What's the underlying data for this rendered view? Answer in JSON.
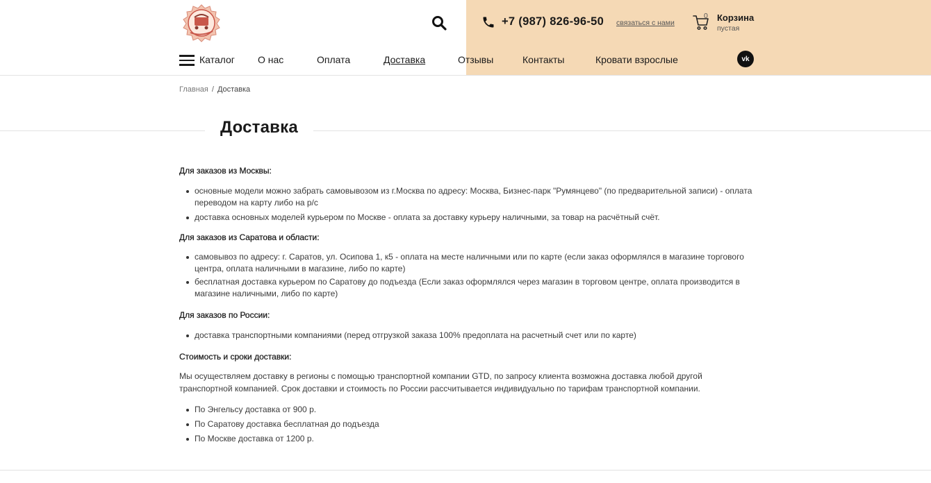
{
  "header": {
    "logo_icon": "home-baby-logo",
    "search_icon": "search-icon",
    "phone_icon": "phone-icon",
    "phone": "+7 (987) 826-96-50",
    "contact_link": "связаться с нами",
    "cart": {
      "icon": "cart-icon",
      "count": "0",
      "title": "Корзина",
      "status": "пустая"
    },
    "peach_color": "#f5d9b5"
  },
  "nav": {
    "catalog": "Каталог",
    "items": [
      "О нас",
      "Оплата",
      "Доставка",
      "Отзывы",
      "Контакты",
      "Кровати взрослые"
    ],
    "active": "Доставка",
    "vk_label": "vk"
  },
  "breadcrumb": {
    "home": "Главная",
    "separator": "/",
    "current": "Доставка"
  },
  "page_title": "Доставка",
  "sections": {
    "moscow": {
      "heading": "Для заказов из Москвы:",
      "items": [
        "основные модели можно забрать самовывозом из г.Москва по адресу: Москва, Бизнес-парк \"Румянцево\" (по предварительной записи) - оплата переводом на карту либо на р/с",
        "доставка основных моделей курьером по Москве - оплата за доставку курьеру наличными, за товар на расчётный счёт."
      ]
    },
    "saratov": {
      "heading": "Для заказов из Саратова и области:",
      "items": [
        "самовывоз по адресу: г. Саратов, ул. Осипова 1, к5 - оплата на месте наличными или по карте (если заказ оформлялся в магазине торгового центра, оплата наличными в магазине, либо по карте)",
        "бесплатная доставка курьером по Саратову до подъезда (Если заказ оформлялся через магазин в торговом центре, оплата производится в магазине наличными, либо по карте)"
      ]
    },
    "russia": {
      "heading": "Для заказов по России:",
      "items": [
        "доставка транспортными компаниями (перед отгрузкой заказа 100% предоплата на расчетный счет или по карте)"
      ]
    },
    "cost": {
      "heading": "Стоимость и сроки доставки:",
      "paragraph": "Мы осуществляем доставку в регионы с помощью транспортной компании GTD, по запросу клиента возможна доставка любой другой транспортной компанией. Срок доставки и стоимость по России рассчитывается индивидуально по тарифам транспортной компании.",
      "items": [
        "По Энгельсу доставка от 900 р.",
        "По Саратову доставка бесплатная до подъезда",
        "По Москве доставка от 1200 р."
      ]
    }
  }
}
